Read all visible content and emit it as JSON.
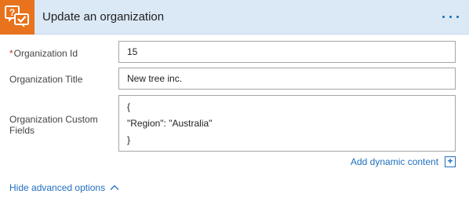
{
  "header": {
    "title": "Update an organization",
    "app_icon": "zendesk-question-check-icon",
    "menu_icon": "more-options-icon",
    "accent_color": "#e8731c",
    "header_bg": "#dbe8f6"
  },
  "fields": {
    "org_id": {
      "required_mark": "*",
      "label": "Organization Id",
      "value": "15"
    },
    "org_title": {
      "label": "Organization Title",
      "value": "New tree inc."
    },
    "custom_fields": {
      "label_line1": "Organization Custom",
      "label_line2": "Fields",
      "lines": [
        "{",
        "\"Region\": \"Australia\"",
        "}"
      ]
    }
  },
  "dynamic_content": {
    "label": "Add dynamic content",
    "icon": "plus-box-icon",
    "icon_glyph": "+"
  },
  "advanced": {
    "label": "Hide advanced options",
    "icon": "chevron-up-icon"
  },
  "colors": {
    "link": "#1f6fbf",
    "required": "#c0392b"
  }
}
